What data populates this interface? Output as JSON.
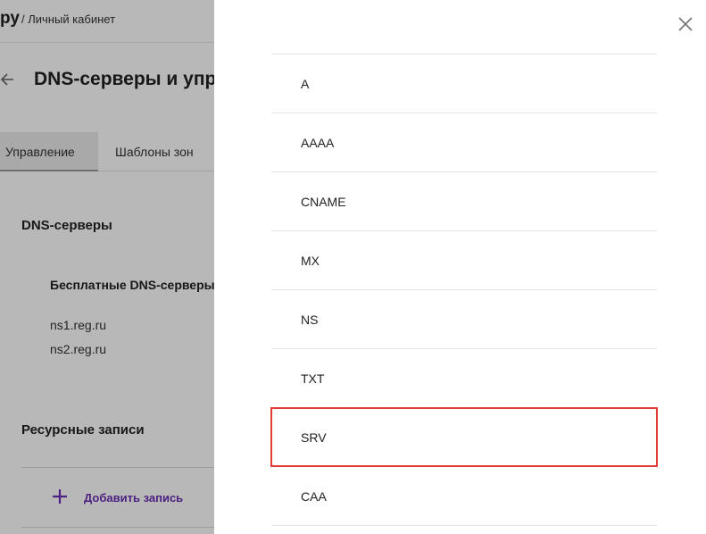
{
  "background": {
    "logo_fragment": "ру",
    "breadcrumb": "/ Личный кабинет",
    "page_title": "DNS-серверы и упр",
    "tabs": [
      {
        "label": "Управление"
      },
      {
        "label": "Шаблоны зон"
      }
    ],
    "dns_section_title": "DNS-серверы",
    "free_dns_title": "Бесплатные DNS-серверы",
    "ns_list": [
      "ns1.reg.ru",
      "ns2.reg.ru"
    ],
    "records_title": "Ресурсные записи",
    "add_record_label": "Добавить запись"
  },
  "panel": {
    "close_icon": "close-icon",
    "record_types": [
      {
        "label": "A"
      },
      {
        "label": "AAAA"
      },
      {
        "label": "CNAME"
      },
      {
        "label": "MX"
      },
      {
        "label": "NS"
      },
      {
        "label": "TXT"
      },
      {
        "label": "SRV",
        "highlighted": true
      },
      {
        "label": "CAA"
      }
    ]
  },
  "colors": {
    "accent": "#6b2fb3",
    "highlight": "#e53935"
  }
}
